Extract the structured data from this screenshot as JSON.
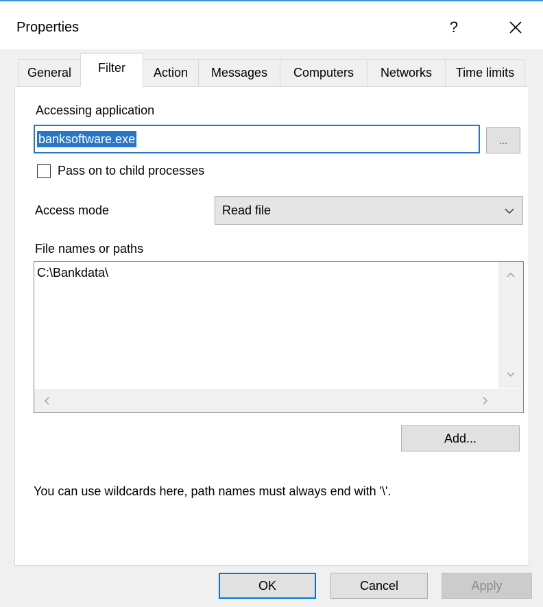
{
  "window": {
    "title": "Properties",
    "help_glyph": "?"
  },
  "tabs": [
    {
      "label": "General",
      "active": false
    },
    {
      "label": "Filter",
      "active": true
    },
    {
      "label": "Action",
      "active": false
    },
    {
      "label": "Messages",
      "active": false
    },
    {
      "label": "Computers",
      "active": false
    },
    {
      "label": "Networks",
      "active": false
    },
    {
      "label": "Time limits",
      "active": false
    }
  ],
  "filter": {
    "accessing_application_label": "Accessing application",
    "application_value": "banksoftware.exe",
    "browse_label": "...",
    "pass_on_label": "Pass on to child processes",
    "pass_on_checked": false,
    "access_mode_label": "Access mode",
    "access_mode_value": "Read file",
    "file_names_label": "File names or paths",
    "file_paths": [
      "C:\\Bankdata\\"
    ],
    "add_label": "Add...",
    "hint": "You can use wildcards here, path names must always end with '\\'."
  },
  "buttons": {
    "ok": "OK",
    "cancel": "Cancel",
    "apply": "Apply"
  },
  "colors": {
    "accent": "#0078d7",
    "selection": "#2a76c6"
  }
}
